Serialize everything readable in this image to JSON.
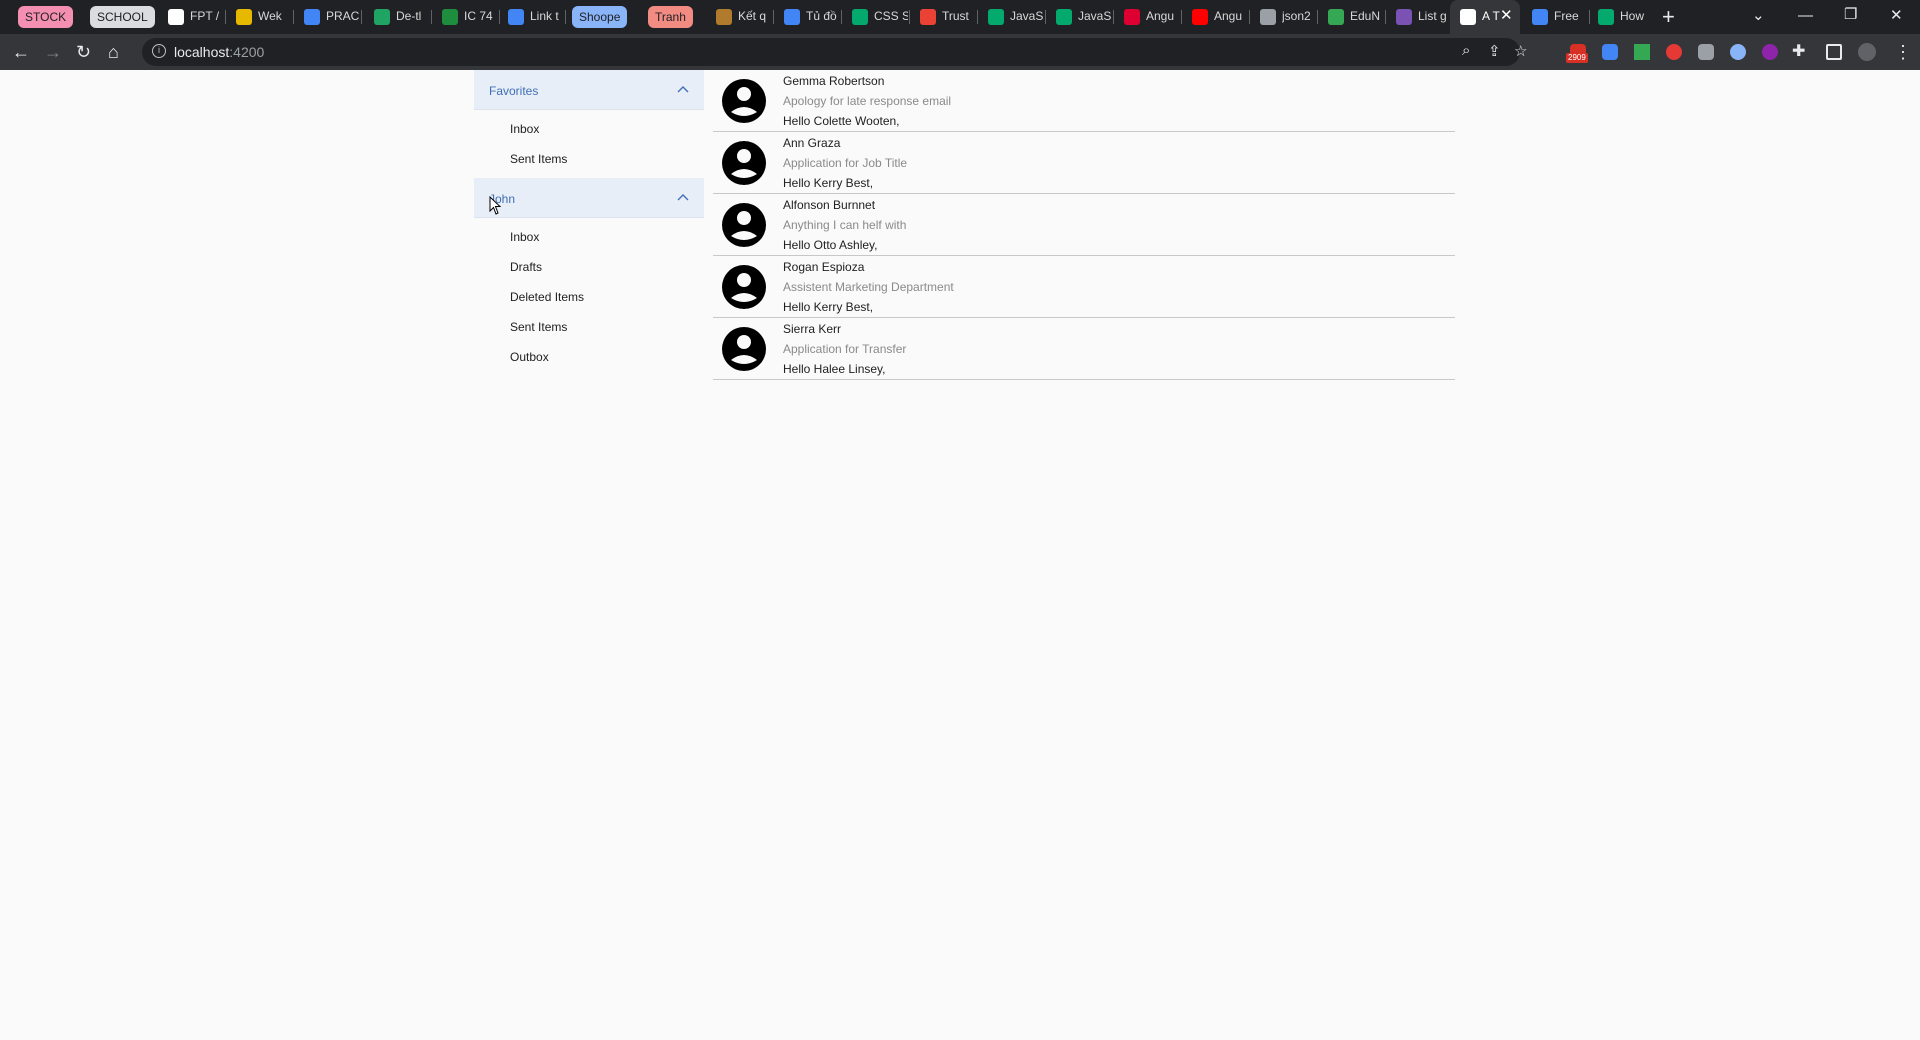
{
  "browser": {
    "tab_groups": [
      {
        "label": "STOCK",
        "color": "#f48fb1"
      },
      {
        "label": "SCHOOL",
        "color": "#dadce0"
      },
      {
        "label": "Shoope",
        "color": "#8ab4f8"
      },
      {
        "label": "Tranh",
        "color": "#f28b82"
      }
    ],
    "tabs": [
      {
        "title": "FPT /",
        "icon": "fpt-icon",
        "color": "#ffffff"
      },
      {
        "title": "Wek",
        "icon": "weka-icon",
        "color": "#e6b800"
      },
      {
        "title": "PRAC",
        "icon": "slides-icon",
        "color": "#4285f4"
      },
      {
        "title": "De-tl",
        "icon": "drive-icon",
        "color": "#1fa463"
      },
      {
        "title": "IC 74",
        "icon": "classroom-icon",
        "color": "#1e8e3e"
      },
      {
        "title": "Link t",
        "icon": "docs-icon",
        "color": "#4285f4"
      },
      {
        "title": "Kết q",
        "icon": "box-icon",
        "color": "#b07b2c"
      },
      {
        "title": "Tủ đồ",
        "icon": "cube-icon",
        "color": "#4285f4"
      },
      {
        "title": "CSS S",
        "icon": "w3-icon",
        "color": "#04aa6d"
      },
      {
        "title": "Trust",
        "icon": "trust-icon",
        "color": "#ea4335"
      },
      {
        "title": "JavaS",
        "icon": "w3-icon",
        "color": "#04aa6d"
      },
      {
        "title": "JavaS",
        "icon": "w3-icon",
        "color": "#04aa6d"
      },
      {
        "title": "Angu",
        "icon": "angular-icon",
        "color": "#dd0031"
      },
      {
        "title": "Angu",
        "icon": "youtube-icon",
        "color": "#ff0000"
      },
      {
        "title": "json2",
        "icon": "globe-icon",
        "color": "#9aa0a6"
      },
      {
        "title": "EduN",
        "icon": "edu-icon",
        "color": "#34a853"
      },
      {
        "title": "List g",
        "icon": "bootstrap-icon",
        "color": "#7952b3"
      },
      {
        "title": "A T",
        "icon": "angular-a-icon",
        "color": "#ffffff",
        "active": true
      },
      {
        "title": "Free",
        "icon": "free-icon",
        "color": "#4285f4"
      },
      {
        "title": "How",
        "icon": "w3-icon",
        "color": "#04aa6d"
      }
    ],
    "url_host": "localhost",
    "url_port": ":4200",
    "ext_badge": "2909"
  },
  "sidebar": {
    "sections": [
      {
        "title": "Favorites",
        "items": [
          "Inbox",
          "Sent Items"
        ]
      },
      {
        "title": "John",
        "items": [
          "Inbox",
          "Drafts",
          "Deleted Items",
          "Sent Items",
          "Outbox"
        ]
      }
    ]
  },
  "mails": [
    {
      "sender": "Gemma Robertson",
      "subject": "Apology for late response email",
      "preview": "Hello Colette Wooten,"
    },
    {
      "sender": "Ann Graza",
      "subject": "Application for Job Title",
      "preview": "Hello Kerry Best,"
    },
    {
      "sender": "Alfonson Burnnet",
      "subject": "Anything I can helf with",
      "preview": "Hello Otto Ashley,"
    },
    {
      "sender": "Rogan Espioza",
      "subject": "Assistent Marketing Department",
      "preview": "Hello Kerry Best,"
    },
    {
      "sender": "Sierra Kerr",
      "subject": "Application for Transfer",
      "preview": "Hello Halee Linsey,"
    }
  ],
  "colors": {
    "accent": "#3f6fb5",
    "header_bg": "#e8eef7"
  }
}
